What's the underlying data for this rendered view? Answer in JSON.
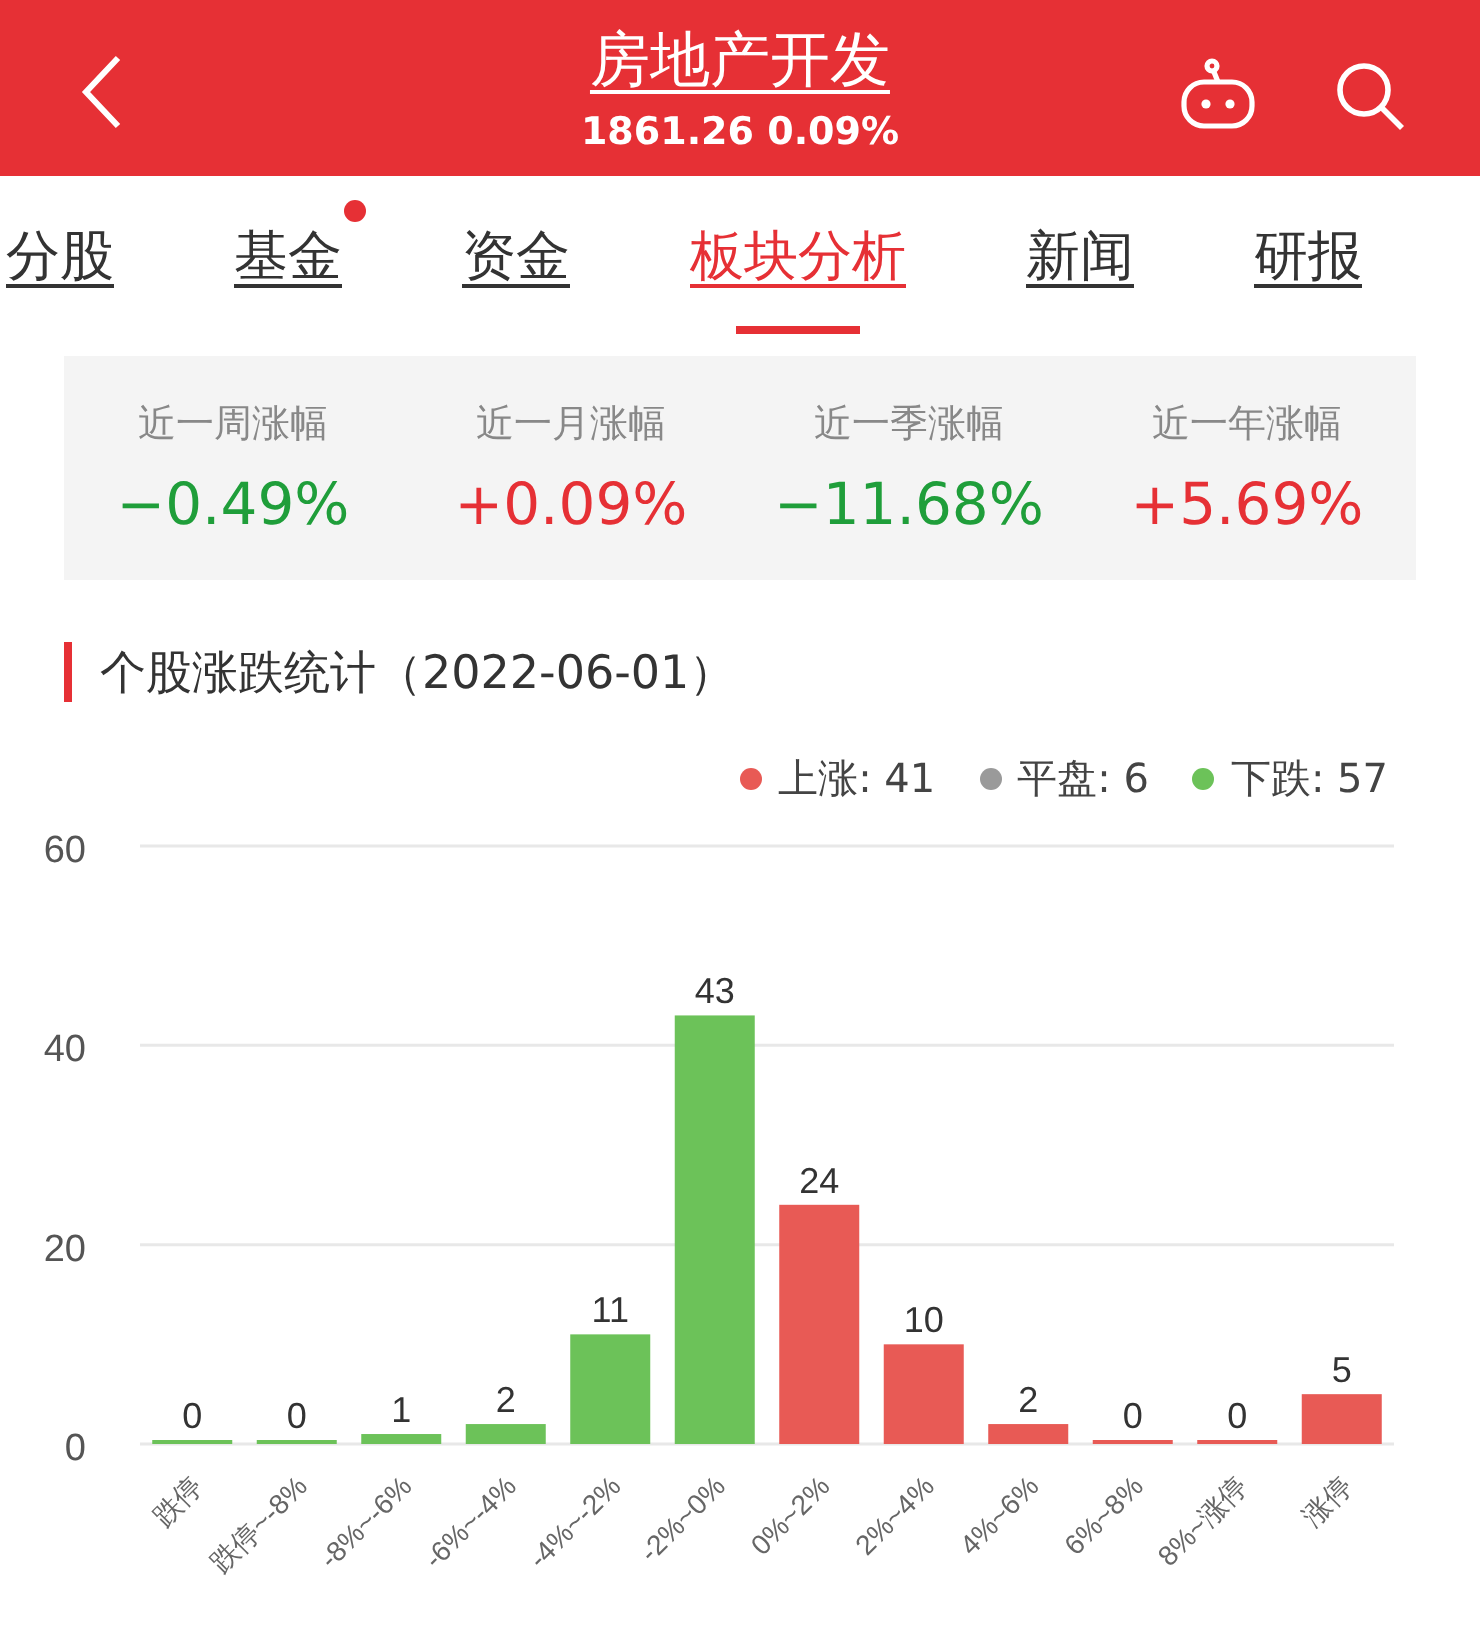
{
  "header": {
    "title": "房地产开发",
    "subtitle": "1861.26 0.09%"
  },
  "tabs": [
    {
      "label": "分股",
      "selected": false,
      "badge": false
    },
    {
      "label": "基金",
      "selected": false,
      "badge": true
    },
    {
      "label": "资金",
      "selected": false,
      "badge": false
    },
    {
      "label": "板块分析",
      "selected": true,
      "badge": false
    },
    {
      "label": "新闻",
      "selected": false,
      "badge": false
    },
    {
      "label": "研报",
      "selected": false,
      "badge": false
    }
  ],
  "stats": [
    {
      "label": "近一周涨幅",
      "value": "−0.49%",
      "kind": "down"
    },
    {
      "label": "近一月涨幅",
      "value": "+0.09%",
      "kind": "up"
    },
    {
      "label": "近一季涨幅",
      "value": "−11.68%",
      "kind": "down"
    },
    {
      "label": "近一年涨幅",
      "value": "+5.69%",
      "kind": "up"
    }
  ],
  "section_title": "个股涨跌统计（2022-06-01）",
  "legend": [
    {
      "label": "上涨: 41",
      "color": "#e85a55"
    },
    {
      "label": "平盘: 6",
      "color": "#9a9a9a"
    },
    {
      "label": "下跌: 57",
      "color": "#6cc259"
    }
  ],
  "chart_data": {
    "type": "bar",
    "data_labels": true,
    "categories": [
      "跌停",
      "跌停~-8%",
      "-8%~-6%",
      "-6%~-4%",
      "-4%~-2%",
      "-2%~0%",
      "0%~2%",
      "2%~4%",
      "4%~6%",
      "6%~8%",
      "8%~涨停",
      "涨停"
    ],
    "ylim": [
      0,
      60
    ],
    "yticks": [
      0,
      20,
      40,
      60
    ],
    "series": [
      {
        "color": "#6cc259",
        "values": [
          0,
          0,
          1,
          2,
          11,
          43,
          null,
          null,
          null,
          null,
          null,
          null
        ]
      },
      {
        "color": "#e85a55",
        "values": [
          null,
          null,
          null,
          null,
          null,
          null,
          24,
          10,
          2,
          0,
          0,
          5
        ]
      }
    ]
  }
}
